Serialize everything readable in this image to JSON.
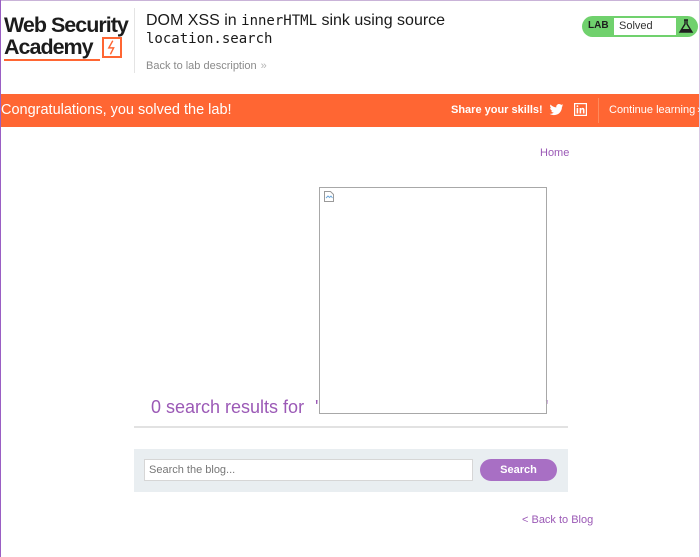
{
  "header": {
    "logo": {
      "line1": "Web Security",
      "line2": "Academy"
    },
    "title": {
      "prefix": "DOM XSS in ",
      "code1": "innerHTML",
      "middle": " sink using source",
      "code2": "location.search"
    },
    "back_link": "Back to lab description",
    "status": {
      "badge": "LAB",
      "state": "Solved",
      "color": "#70d16d"
    }
  },
  "banner": {
    "message": "Congratulations, you solved the lab!",
    "share": "Share your skills!",
    "continue": "Continue learning",
    "color": "#ff6633",
    "icons": [
      "twitter-icon",
      "linkedin-icon"
    ]
  },
  "nav": {
    "home": "Home"
  },
  "search_results": {
    "text": "0 search results for ",
    "quote_open": "'",
    "quote_close": "'"
  },
  "search": {
    "placeholder": "Search the blog...",
    "button": "Search"
  },
  "footer": {
    "back_to_blog": "< Back to Blog"
  },
  "colors": {
    "accent": "#9b59b6",
    "button": "#a86fc4"
  }
}
